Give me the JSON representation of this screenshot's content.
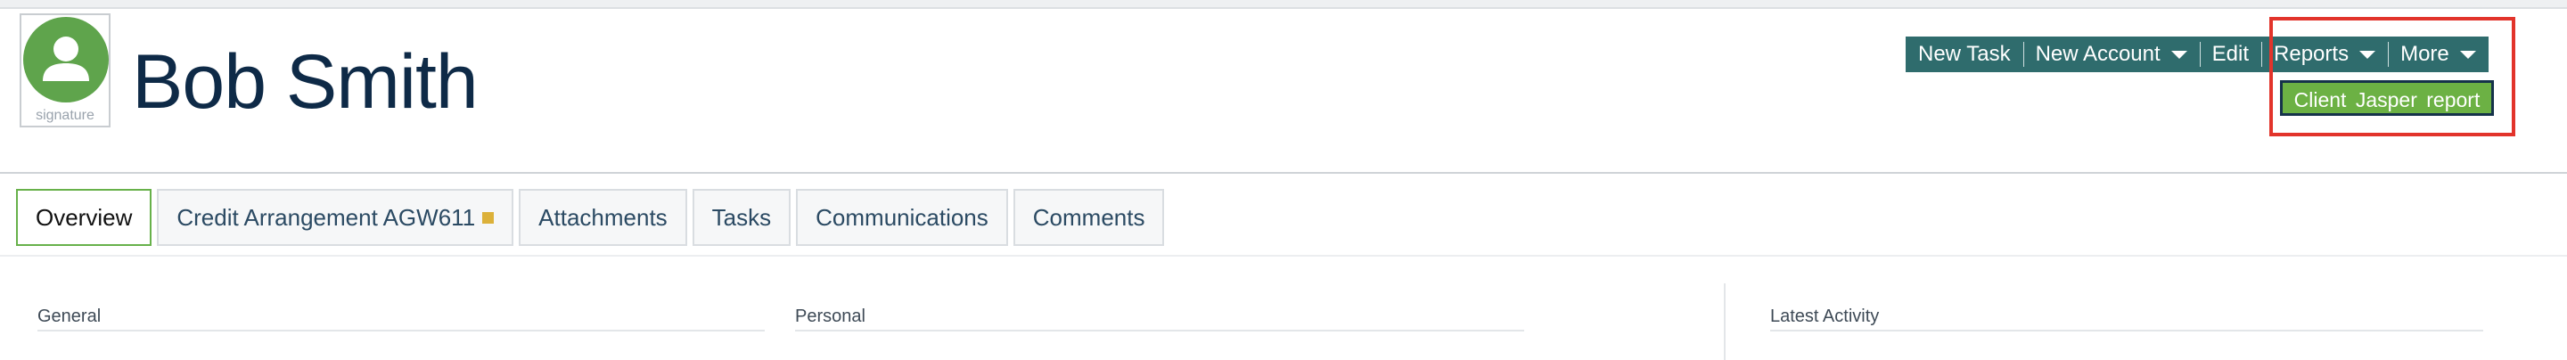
{
  "header": {
    "avatar_icon": "user-icon",
    "avatar_caption": "signature",
    "title": "Bob Smith"
  },
  "toolbar": {
    "buttons": [
      {
        "label": "New Task",
        "has_caret": false
      },
      {
        "label": "New Account",
        "has_caret": true
      },
      {
        "label": "Edit",
        "has_caret": false
      },
      {
        "label": "Reports",
        "has_caret": true
      },
      {
        "label": "More",
        "has_caret": true
      }
    ],
    "reports_dropdown": {
      "item": "Client Jasper report"
    }
  },
  "tabs": [
    {
      "label": "Overview",
      "active": true
    },
    {
      "label": "Credit Arrangement AGW611",
      "active": false,
      "flag_color": "#dcb13a"
    },
    {
      "label": "Attachments",
      "active": false
    },
    {
      "label": "Tasks",
      "active": false
    },
    {
      "label": "Communications",
      "active": false
    },
    {
      "label": "Comments",
      "active": false
    }
  ],
  "sections": {
    "general": "General",
    "personal": "Personal",
    "latest_activity": "Latest Activity"
  },
  "colors": {
    "toolbar_bg": "#2f6c6d",
    "accent_green": "#6cb144",
    "highlight_red": "#e2342b",
    "title": "#0e2a47"
  }
}
